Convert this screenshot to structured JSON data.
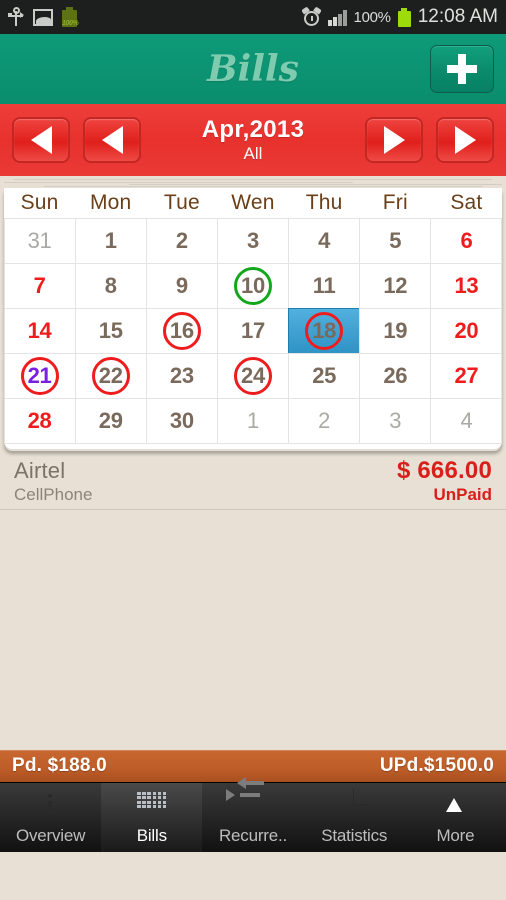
{
  "status_bar": {
    "left_icons": [
      "usb-icon",
      "picture-icon",
      "battery-olive-icon"
    ],
    "battery_olive_label": "100%",
    "right_icons": [
      "alarm-icon",
      "signal-icon",
      "battery-green-icon"
    ],
    "battery_percent": "100%",
    "clock": "12:08 AM"
  },
  "title_bar": {
    "app_title": "Bills",
    "add_button_label": "+",
    "bg_color": "#0a8d6d",
    "title_color": "#7ecbb0"
  },
  "nav_bar": {
    "month": "Apr,2013",
    "filter": "All",
    "prev_year_icon": "triangle-left-icon",
    "prev_month_icon": "triangle-left-icon",
    "next_month_icon": "triangle-right-icon",
    "next_year_icon": "triangle-right-icon",
    "bg_color": "#e8312d"
  },
  "calendar": {
    "day_headers": [
      "Sun",
      "Mon",
      "Tue",
      "Wen",
      "Thu",
      "Fri",
      "Sat"
    ],
    "header_color": "#6b3f18",
    "weeks": [
      [
        {
          "day": "31",
          "type": "other"
        },
        {
          "day": "1",
          "type": "normal"
        },
        {
          "day": "2",
          "type": "normal"
        },
        {
          "day": "3",
          "type": "normal"
        },
        {
          "day": "4",
          "type": "normal"
        },
        {
          "day": "5",
          "type": "normal"
        },
        {
          "day": "6",
          "type": "weekend"
        }
      ],
      [
        {
          "day": "7",
          "type": "weekend"
        },
        {
          "day": "8",
          "type": "normal"
        },
        {
          "day": "9",
          "type": "normal"
        },
        {
          "day": "10",
          "type": "normal",
          "mark": "green"
        },
        {
          "day": "11",
          "type": "normal"
        },
        {
          "day": "12",
          "type": "normal"
        },
        {
          "day": "13",
          "type": "weekend"
        }
      ],
      [
        {
          "day": "14",
          "type": "weekend"
        },
        {
          "day": "15",
          "type": "normal"
        },
        {
          "day": "16",
          "type": "normal",
          "mark": "red"
        },
        {
          "day": "17",
          "type": "normal"
        },
        {
          "day": "18",
          "type": "normal",
          "mark": "red",
          "selected": true
        },
        {
          "day": "19",
          "type": "normal"
        },
        {
          "day": "20",
          "type": "weekend"
        }
      ],
      [
        {
          "day": "21",
          "type": "today",
          "mark": "red"
        },
        {
          "day": "22",
          "type": "normal",
          "mark": "red"
        },
        {
          "day": "23",
          "type": "normal"
        },
        {
          "day": "24",
          "type": "normal",
          "mark": "red"
        },
        {
          "day": "25",
          "type": "normal"
        },
        {
          "day": "26",
          "type": "normal"
        },
        {
          "day": "27",
          "type": "weekend"
        }
      ],
      [
        {
          "day": "28",
          "type": "weekend"
        },
        {
          "day": "29",
          "type": "normal"
        },
        {
          "day": "30",
          "type": "normal"
        },
        {
          "day": "1",
          "type": "other"
        },
        {
          "day": "2",
          "type": "other"
        },
        {
          "day": "3",
          "type": "other"
        },
        {
          "day": "4",
          "type": "other"
        }
      ]
    ],
    "selected_day": "18",
    "today_day": "21",
    "selected_bg_color": "#2f93c6",
    "mark_red_color": "#ee1c1c",
    "mark_green_color": "#13a81b",
    "today_text_color": "#7a1ee0"
  },
  "bills": [
    {
      "name": "Airtel",
      "category": "CellPhone",
      "amount": "$ 666.00",
      "status": "UnPaid",
      "amount_color": "#d8201a"
    }
  ],
  "summary": {
    "paid": "Pd. $188.0",
    "unpaid": "UPd.$1500.0",
    "bg_color": "#bd5d28"
  },
  "tabs": [
    {
      "label": "Overview",
      "icon": "info-icon",
      "active": false
    },
    {
      "label": "Bills",
      "icon": "calendar-icon",
      "active": true
    },
    {
      "label": "Recurre..",
      "icon": "recurring-icon",
      "active": false
    },
    {
      "label": "Statistics",
      "icon": "pie-chart-icon",
      "active": false
    },
    {
      "label": "More",
      "icon": "more-up-icon",
      "active": false
    }
  ]
}
